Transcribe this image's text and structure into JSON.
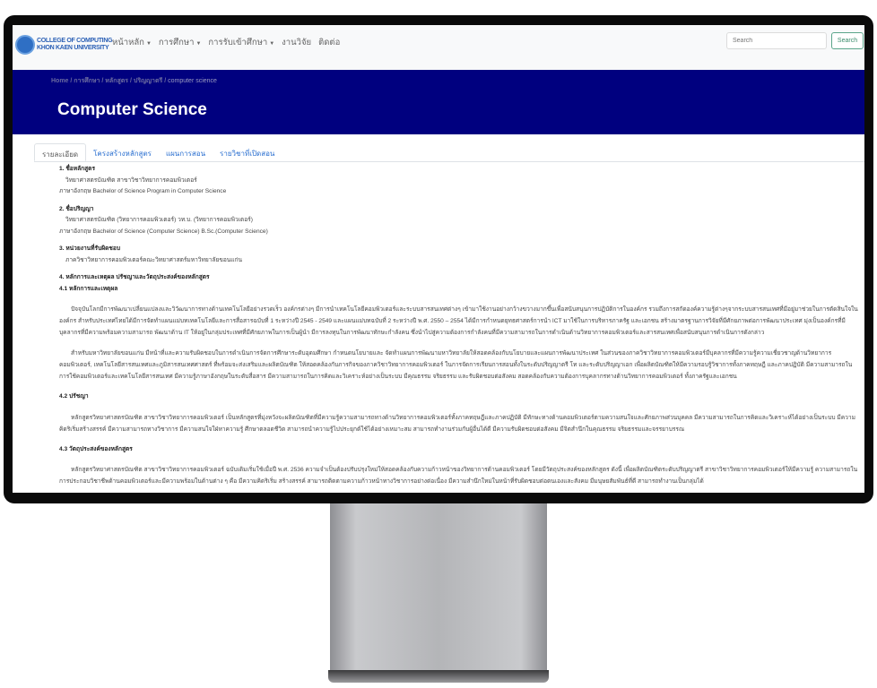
{
  "nav": {
    "logo_line1": "COLLEGE OF COMPUTING",
    "logo_line2": "KHON KAEN UNIVERSITY",
    "items": [
      {
        "label": "หน้าหลัก",
        "dropdown": true
      },
      {
        "label": "การศึกษา",
        "dropdown": true
      },
      {
        "label": "การรับเข้าศึกษา",
        "dropdown": true
      },
      {
        "label": "งานวิจัย",
        "dropdown": false
      },
      {
        "label": "ติดต่อ",
        "dropdown": false
      }
    ],
    "search_placeholder": "Search",
    "search_button": "Search"
  },
  "banner": {
    "breadcrumb": [
      "Home",
      "การศึกษา",
      "หลักสูตร",
      "ปริญญาตรี"
    ],
    "breadcrumb_current": "computer science",
    "title": "Computer Science",
    "color": "#00007f"
  },
  "tabs": [
    "รายละเอียด",
    "โครงสร้างหลักสูตร",
    "แผนการสอน",
    "รายวิชาที่เปิดสอน"
  ],
  "content": {
    "s1_title": "1. ชื่อหลักสูตร",
    "s1_th": "วิทยาศาสตรบัณฑิต สาขาวิชาวิทยาการคอมพิวเตอร์",
    "s1_en": "ภาษาอังกฤษ Bachelor of Science Program in Computer Science",
    "s2_title": "2. ชื่อปริญญา",
    "s2_th": "วิทยาศาสตรบัณฑิต (วิทยาการคอมพิวเตอร์) วท.บ. (วิทยาการคอมพิวเตอร์)",
    "s2_en": "ภาษาอังกฤษ Bachelor of Science (Computer Science) B.Sc.(Computer Science)",
    "s3_title": "3. หน่วยงานที่รับผิดชอบ",
    "s3_text": "ภาควิชาวิทยาการคอมพิวเตอร์คณะวิทยาศาสตร์มหาวิทยาลัยขอนแก่น",
    "s4_title": "4. หลักการและเหตุผล ปรัชญาและวัตถุประสงค์ของหลักสูตร",
    "s41_title": "4.1 หลักการและเหตุผล",
    "s41_p1": "ปัจจุบันโลกมีการพัฒนาเปลี่ยนแปลงและวิวัฒนาการทางด้านเทคโนโลยีอย่างรวดเร็ว องค์กรต่างๆ มีการนำเทคโนโลยีคอมพิวเตอร์และระบบสารสนเทศต่างๆ เข้ามาใช้งานอย่างกว้างขวางมากขึ้นเพื่อสนับสนุนการปฏิบัติการในองค์กร รวมถึงการสกัดองค์ความรู้ต่างๆจากระบบสารสนเทศที่มีอยู่มาช่วยในการตัดสินใจในองค์กร สำหรับประเทศไทยได้มีการจัดทำแผนแม่บทเทคโนโลยีและการสื่อสารฉบับที่ 1 ระหว่างปี 2545 - 2549 และแผนแม่บทฉบับที่ 2 ระหว่างปี พ.ศ. 2550 – 2554 ได้มีการกำหนดยุทธศาสตร์การนำ ICT มาใช้ในการบริหารภาครัฐ และเอกชน สร้างมาตรฐานการวิจัยที่มีศักยภาพต่อการพัฒนาประเทศ มุ่งเป็นองค์กรที่มีบุคลากรที่มีความพร้อมความสามารถ พัฒนาด้าน IT ให้อยู่ในกลุ่มประเทศที่มีศักยภาพในการเป็นผู้นำ มีการลงทุนในการพัฒนาทักษะกำลังคน ซึ่งนำไปสู่ความต้องการกำลังคนที่มีความสามารถในการดำเนินด้านวิทยาการคอมพิวเตอร์และสารสนเทศเพื่อสนับสนุนการดำเนินการดังกล่าว",
    "s41_p2": "สำหรับมหาวิทยาลัยขอนแก่น มีหน้าที่และความรับผิดชอบในการดำเนินการจัดการศึกษาระดับอุดมศึกษา กำหนดนโยบายและ จัดทำแผนการพัฒนามหาวิทยาลัยให้สอดคล้องกับนโยบายและแผนการพัฒนาประเทศ ในส่วนของภาควิชาวิทยาการคอมพิวเตอร์มีบุคลากรที่มีความรู้ความเชี่ยวชาญด้านวิทยาการคอมพิวเตอร์, เทคโนโลยีสารสนเทศและภูมิสารสนเทศศาสตร์ ที่พร้อมจะส่งเสริมและผลิตบัณฑิต ให้สอดคล้องกับภารกิจของภาควิชาวิทยาการคอมพิวเตอร์ ในการจัดการเรียนการสอนทั้งในระดับปริญญาตรี โท และระดับปริญญาเอก เพื่อผลิตบัณฑิตให้มีความรอบรู้วิชาการทั้งภาคทฤษฎี และภาคปฏิบัติ มีความสามารถในการใช้คอมพิวเตอร์และเทคโนโลยีสารสนเทศ มีความรู้ภาษาอังกฤษในระดับสื่อสาร มีความสามารถในการคิดและวิเคราะห์อย่างเป็นระบบ มีคุณธรรม จริยธรรม และรับผิดชอบต่อสังคม สอดคล้องกับความต้องการบุคลากรทางด้านวิทยาการคอมพิวเตอร์ ทั้งภาครัฐและเอกชน",
    "s42_title": "4.2 ปรัชญา",
    "s42_p": "หลักสูตรวิทยาศาสตรบัณฑิต สาขาวิชาวิทยาการคอมพิวเตอร์ เป็นหลักสูตรที่มุ่งหวังจะผลิตบัณฑิตที่มีความรู้ความสามารถทางด้านวิทยาการคอมพิวเตอร์ทั้งภาคทฤษฎีและภาคปฏิบัติ มีทักษะทางด้านคอมพิวเตอร์ตามความสนใจและศักยภาพส่วนบุคคล มีความสามารถในการคิดและวิเคราะห์ได้อย่างเป็นระบบ มีความคิดริเริ่มสร้างสรรค์ มีความสามารถทางวิชาการ มีความสนใจใฝ่หาความรู้ ศึกษาตลอดชีวิต สามารถนำความรู้ไปประยุกต์ใช้ได้อย่างเหมาะสม สามารถทำงานร่วมกับผู้อื่นได้ดี มีความรับผิดชอบต่อสังคม มีจิตสำนึกในคุณธรรม จริยธรรมและจรรยาบรรณ",
    "s43_title": "4.3 วัตถุประสงค์ของหลักสูตร",
    "s43_p": "หลักสูตรวิทยาศาสตรบัณฑิต สาขาวิชาวิทยาการคอมพิวเตอร์ ฉบับเดิมเริ่มใช้เมื่อปี พ.ศ. 2536 ความจำเป็นต้องปรับปรุงใหม่ให้สอดคล้องกับความก้าวหน้าของวิทยาการด้านคอมพิวเตอร์ โดยมีวัตถุประสงค์ของหลักสูตร ดังนี้ เพื่อผลิตบัณฑิตระดับปริญญาตรี สาขาวิชาวิทยาการคอมพิวเตอร์ให้มีความรู้ ความสามารถในการประกอบวิชาชีพด้านคอมพิวเตอร์และมีความพร้อมในด้านต่าง ๆ คือ มีความคิดริเริ่ม สร้างสรรค์ สามารถติดตามความก้าวหน้าทางวิชาการอย่างต่อเนื่อง มีความสำนึกใหม่ในหน้าที่รับผิดชอบต่อตนเองและสังคม มีมนุษยสัมพันธ์ที่ดี สามารถทำงานเป็นกลุ่มได้"
  }
}
